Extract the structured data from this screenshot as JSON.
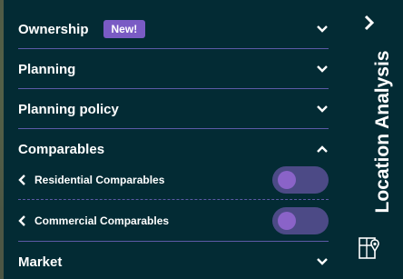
{
  "sections": {
    "ownership": {
      "label": "Ownership",
      "badge": "New!"
    },
    "planning": {
      "label": "Planning"
    },
    "planning_policy": {
      "label": "Planning policy"
    },
    "comparables": {
      "label": "Comparables",
      "items": [
        {
          "label": "Residential Comparables",
          "toggle_on": false
        },
        {
          "label": "Commercial Comparables",
          "toggle_on": false
        }
      ]
    },
    "market": {
      "label": "Market"
    }
  },
  "sidebar": {
    "title": "Location Analysis",
    "icon": "map-location-icon"
  },
  "colors": {
    "panel": "#032b34",
    "accent": "#7a5bc4",
    "divider": "#5c5aa6",
    "toggle_track": "#4c4a86"
  }
}
